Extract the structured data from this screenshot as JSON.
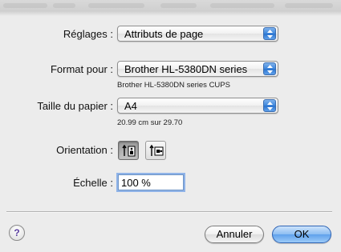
{
  "labels": {
    "settings": "Réglages :",
    "format_for": "Format pour :",
    "paper_size": "Taille du papier :",
    "orientation": "Orientation :",
    "scale": "Échelle :"
  },
  "settings_popup": {
    "selected": "Attributs de page"
  },
  "format_popup": {
    "selected": "Brother HL-5380DN series",
    "subtitle": "Brother HL-5380DN series CUPS"
  },
  "paper_popup": {
    "selected": "A4",
    "dimensions": "20.99 cm sur 29.70"
  },
  "orientation": {
    "options": [
      {
        "name": "portrait",
        "icon": "portrait-orientation-icon",
        "selected": true
      },
      {
        "name": "landscape",
        "icon": "landscape-orientation-icon",
        "selected": false
      }
    ]
  },
  "scale_field": {
    "value": "100 %"
  },
  "buttons": {
    "help": "?",
    "cancel": "Annuler",
    "ok": "OK"
  },
  "colors": {
    "default_button": "#5fa1ec",
    "stepper": "#3d86dd",
    "focus_ring": "#8fb3e8"
  }
}
